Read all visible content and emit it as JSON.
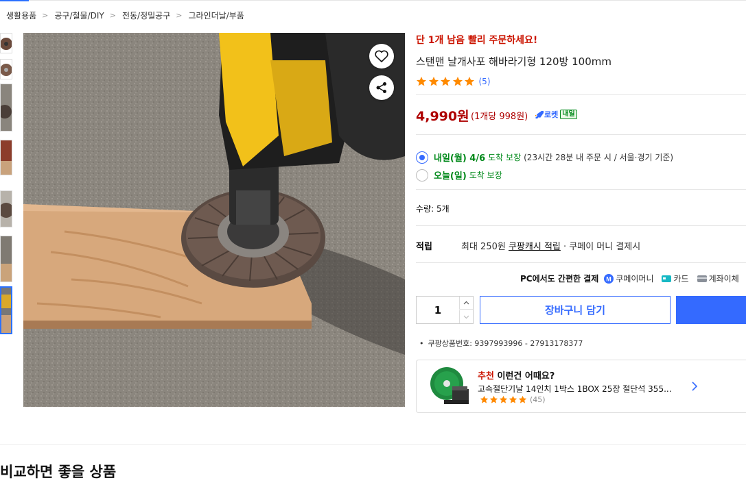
{
  "breadcrumb": [
    "생활용품",
    "공구/철물/DIY",
    "전동/정밀공구",
    "그라인더날/부품"
  ],
  "thumbnails": [
    "flap-disc-top",
    "flap-disc-side",
    "disc-on-tool",
    "grinder-in-use",
    "disc-closeup",
    "drill-with-disc",
    "drill-on-wood"
  ],
  "product": {
    "urgent_notice": "단 1개 남음 빨리 주문하세요!",
    "title": "스탠맨 날개사포 해바라기형 120방 100mm",
    "rating": 5,
    "review_count": "(5)",
    "price": "4,990원",
    "unit_price": "(1개당 998원)",
    "rocket_label": "로켓",
    "rocket_tag": "내일"
  },
  "delivery": {
    "option1": {
      "main": "내일(월) 4/6",
      "suffix": "도착 보장",
      "note": "(23시간 28분 내 주문 시 / 서울·경기 기준)",
      "selected": true
    },
    "option2": {
      "main": "오늘(일)",
      "suffix": "도착 보장",
      "selected": false
    }
  },
  "quantity_label": "수량: 5개",
  "points": {
    "label": "적립",
    "prefix": "최대 250원",
    "link": "쿠팡캐시 적립",
    "suffix": "· 쿠페이 머니 결제시"
  },
  "payment": {
    "lead": "PC에서도 간편한 결제",
    "methods": [
      "쿠페이머니",
      "카드",
      "계좌이체"
    ]
  },
  "purchase": {
    "quantity": "1",
    "cart_button": "장바구니 담기"
  },
  "product_number": "쿠팡상품번호: 9397993996 - 27913178377",
  "recommend": {
    "highlight": "추천",
    "heading": "이런건 어때요?",
    "title": "고속절단기날 14인치 1박스 1BOX 25장 절단석 355...",
    "rating": 5,
    "count": "(45)"
  },
  "section_title": "비교하면 좋을 상품",
  "colors": {
    "accent": "#346aff",
    "price": "#ae0000",
    "urgent": "#cb1400",
    "delivery": "#00891a",
    "star": "#ff8a00"
  }
}
